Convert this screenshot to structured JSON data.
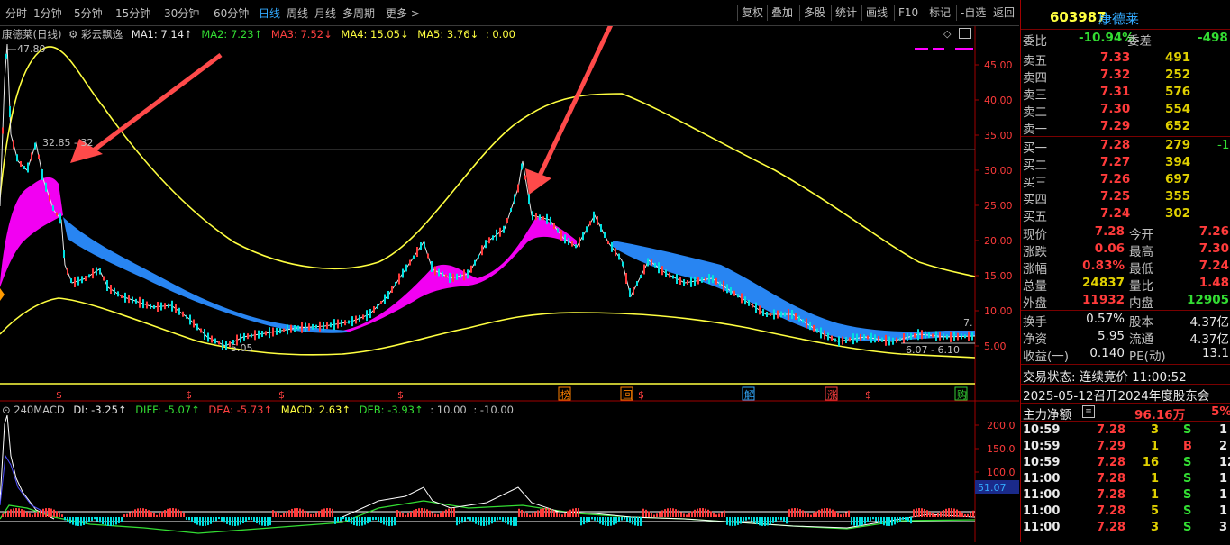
{
  "toolbar": {
    "periods": [
      "分时",
      "1分钟",
      "5分钟",
      "15分钟",
      "30分钟",
      "60分钟",
      "日线",
      "周线",
      "月线",
      "多周期",
      "更多 >"
    ],
    "active_period": "日线",
    "right_buttons": [
      "复权",
      "叠加",
      "多股",
      "统计",
      "画线",
      "F10",
      "标记",
      "-自选",
      "返回"
    ]
  },
  "legend": {
    "stock": "康德莱(日线)",
    "indicator": "彩云飘逸",
    "ma1": "MA1: 7.14↑",
    "ma2": "MA2: 7.23↑",
    "ma3": "MA3: 7.52↓",
    "ma4": "MA4: 15.05↓",
    "ma5": "MA5: 3.76↓",
    "extra": ": 0.00"
  },
  "price_axis": [
    "45.00",
    "40.00",
    "35.00",
    "30.00",
    "25.00",
    "20.00",
    "15.00",
    "10.00",
    "5.00"
  ],
  "annotations": {
    "high": "47.80",
    "level": "32.85 - 32",
    "low": "5.05",
    "range": "6.07 - 6.10",
    "last": "7."
  },
  "event_markers": [
    {
      "label": "$",
      "color": "#ff4040"
    },
    {
      "label": "$",
      "color": "#ff4040"
    },
    {
      "label": "$",
      "color": "#ff4040"
    },
    {
      "label": "$",
      "color": "#ff4040"
    },
    {
      "label": "榜",
      "color": "#ff8000"
    },
    {
      "label": "回",
      "color": "#ff8000"
    },
    {
      "label": "$",
      "color": "#ff4040"
    },
    {
      "label": "解",
      "color": "#33aaff"
    },
    {
      "label": "涨",
      "color": "#ff4040"
    },
    {
      "label": "$",
      "color": "#ff4040"
    },
    {
      "label": "购",
      "color": "#33cc33"
    }
  ],
  "macd_legend": {
    "name": "240MACD",
    "di": "DI: -3.25↑",
    "diff": "DIFF: -5.07↑",
    "dea": "DEA: -5.73↑",
    "macd": "MACD: 2.63↑",
    "deb": "DEB: -3.93↑",
    "p1": ": 10.00",
    "p2": ": -10.00"
  },
  "macd_axis": [
    "200.0",
    "150.0",
    "100.0"
  ],
  "macd_current": "51.07",
  "quote": {
    "code": "603987",
    "name": "康德莱",
    "weibi_label": "委比",
    "weibi": "-10.94%",
    "weicha_label": "委差",
    "weicha": "-498",
    "asks": [
      {
        "label": "卖五",
        "price": "7.33",
        "vol": "491"
      },
      {
        "label": "卖四",
        "price": "7.32",
        "vol": "252"
      },
      {
        "label": "卖三",
        "price": "7.31",
        "vol": "576"
      },
      {
        "label": "卖二",
        "price": "7.30",
        "vol": "554"
      },
      {
        "label": "卖一",
        "price": "7.29",
        "vol": "652"
      }
    ],
    "bids": [
      {
        "label": "买一",
        "price": "7.28",
        "vol": "279",
        "chg": "-1"
      },
      {
        "label": "买二",
        "price": "7.27",
        "vol": "394",
        "chg": ""
      },
      {
        "label": "买三",
        "price": "7.26",
        "vol": "697",
        "chg": ""
      },
      {
        "label": "买四",
        "price": "7.25",
        "vol": "355",
        "chg": ""
      },
      {
        "label": "买五",
        "price": "7.24",
        "vol": "302",
        "chg": ""
      }
    ],
    "stats": [
      {
        "l1": "现价",
        "v1": "7.28",
        "l2": "今开",
        "v2": "7.26"
      },
      {
        "l1": "涨跌",
        "v1": "0.06",
        "l2": "最高",
        "v2": "7.30"
      },
      {
        "l1": "涨幅",
        "v1": "0.83%",
        "l2": "最低",
        "v2": "7.24"
      },
      {
        "l1": "总量",
        "v1": "24837",
        "l2": "量比",
        "v2": "1.48"
      },
      {
        "l1": "外盘",
        "v1": "11932",
        "l2": "内盘",
        "v2": "12905"
      }
    ],
    "stats2": [
      {
        "l1": "换手",
        "v1": "0.57%",
        "l2": "股本",
        "v2": "4.37亿"
      },
      {
        "l1": "净资",
        "v1": "5.95",
        "l2": "流通",
        "v2": "4.37亿"
      },
      {
        "l1": "收益(一)",
        "v1": "0.140",
        "l2": "PE(动)",
        "v2": "13.1"
      }
    ],
    "status": "交易状态: 连续竞价 11:00:52",
    "notice": "2025-05-12召开2024年度股东会",
    "main_flow_label": "主力净额",
    "main_flow_value": "96.16万",
    "main_flow_pct": "5%"
  },
  "trades": [
    {
      "t": "10:59",
      "p": "7.28",
      "v": "3",
      "bs": "S",
      "n": "1"
    },
    {
      "t": "10:59",
      "p": "7.29",
      "v": "1",
      "bs": "B",
      "n": "2"
    },
    {
      "t": "10:59",
      "p": "7.28",
      "v": "16",
      "bs": "S",
      "n": "12"
    },
    {
      "t": "11:00",
      "p": "7.28",
      "v": "1",
      "bs": "S",
      "n": "1"
    },
    {
      "t": "11:00",
      "p": "7.28",
      "v": "1",
      "bs": "S",
      "n": "1"
    },
    {
      "t": "11:00",
      "p": "7.28",
      "v": "5",
      "bs": "S",
      "n": "1"
    },
    {
      "t": "11:00",
      "p": "7.28",
      "v": "3",
      "bs": "S",
      "n": "3"
    }
  ],
  "colors": {
    "up": "#ff3b3b",
    "down": "#00e0e0",
    "magenta_band": "#ff00ff",
    "blue_band": "#2a8cff",
    "yellow_line": "#ffff40",
    "arrow": "#ff4a4a"
  }
}
